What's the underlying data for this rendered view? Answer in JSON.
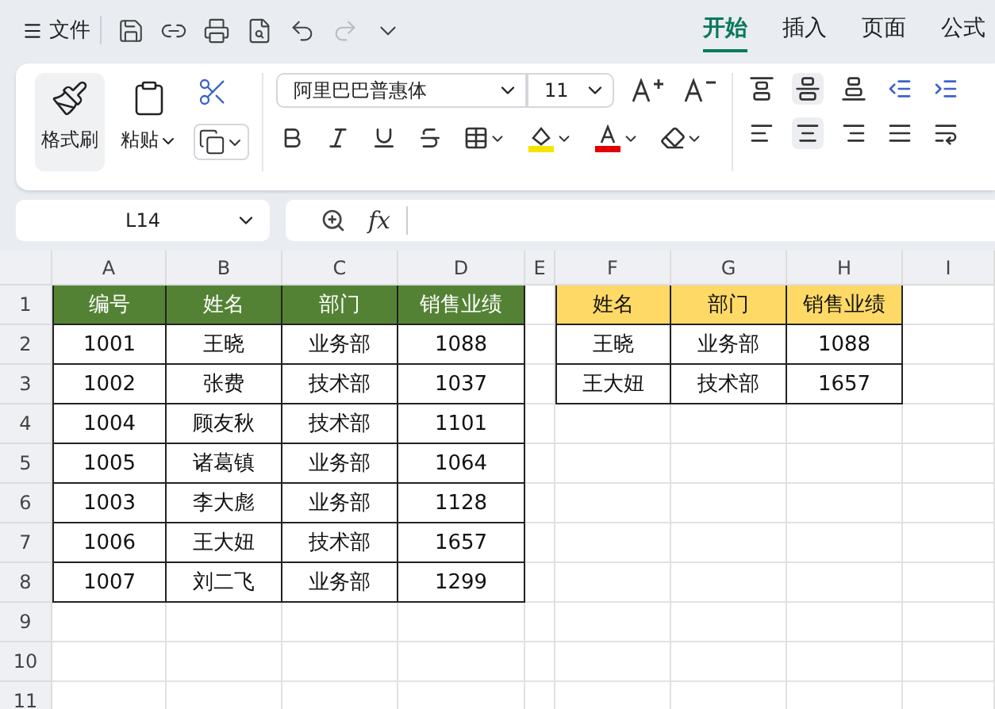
{
  "menu": {
    "label": "文件"
  },
  "ribbon_tabs": [
    {
      "label": "开始",
      "selected": true
    },
    {
      "label": "插入",
      "selected": false
    },
    {
      "label": "页面",
      "selected": false
    },
    {
      "label": "公式",
      "selected": false
    }
  ],
  "ribbon": {
    "format_painter": "格式刷",
    "paste": "粘贴",
    "font_name": "阿里巴巴普惠体",
    "font_size": "11"
  },
  "name_box": "L14",
  "formula_bar": {
    "fx": "fx"
  },
  "sheet": {
    "columns": [
      "A",
      "B",
      "C",
      "D",
      "E",
      "F",
      "G",
      "H",
      "I"
    ],
    "row_numbers": [
      "1",
      "2",
      "3",
      "4",
      "5",
      "6",
      "7",
      "8",
      "9",
      "10",
      "11"
    ],
    "tables": [
      {
        "kind": "green",
        "header": [
          "编号",
          "姓名",
          "部门",
          "销售业绩"
        ],
        "rows": [
          [
            "1001",
            "王晓",
            "业务部",
            "1088"
          ],
          [
            "1002",
            "张费",
            "技术部",
            "1037"
          ],
          [
            "1004",
            "顾友秋",
            "技术部",
            "1101"
          ],
          [
            "1005",
            "诸葛镇",
            "业务部",
            "1064"
          ],
          [
            "1003",
            "李大彪",
            "业务部",
            "1128"
          ],
          [
            "1006",
            "王大妞",
            "技术部",
            "1657"
          ],
          [
            "1007",
            "刘二飞",
            "业务部",
            "1299"
          ]
        ]
      },
      {
        "kind": "yellow",
        "header": [
          "姓名",
          "部门",
          "销售业绩"
        ],
        "rows": [
          [
            "王晓",
            "业务部",
            "1088"
          ],
          [
            "王大妞",
            "技术部",
            "1657"
          ]
        ]
      }
    ]
  }
}
